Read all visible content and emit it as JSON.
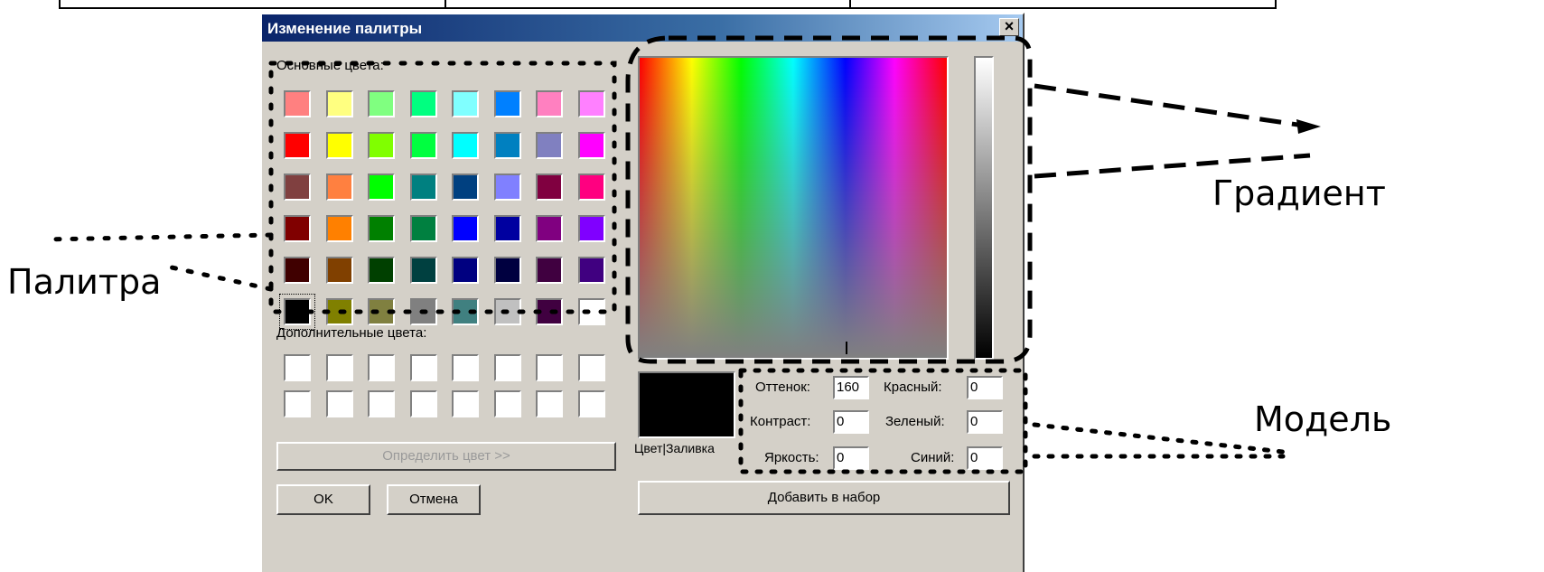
{
  "dialog": {
    "title": "Изменение палитры",
    "close_label": "×",
    "basic_colors_label": "Основные цвета:",
    "custom_colors_label": "Дополнительные цвета:",
    "define_button": "Определить цвет >>",
    "ok_button": "OK",
    "cancel_button": "Отмена",
    "add_button": "Добавить в набор",
    "color_fill_label": "Цвет|Заливка",
    "hue_label": "Оттенок:",
    "hue_value": "160",
    "sat_label": "Контраст:",
    "sat_value": "0",
    "lum_label": "Яркость:",
    "lum_value": "0",
    "red_label": "Красный:",
    "red_value": "0",
    "green_label": "Зеленый:",
    "green_value": "0",
    "blue_label": "Синий:",
    "blue_value": "0",
    "basic_colors": [
      [
        "#ff8080",
        "#ffff80",
        "#80ff80",
        "#00ff80",
        "#80ffff",
        "#0080ff",
        "#ff80c0",
        "#ff80ff"
      ],
      [
        "#ff0000",
        "#ffff00",
        "#80ff00",
        "#00ff40",
        "#00ffff",
        "#0080c0",
        "#8080c0",
        "#ff00ff"
      ],
      [
        "#804040",
        "#ff8040",
        "#00ff00",
        "#008080",
        "#004080",
        "#8080ff",
        "#800040",
        "#ff0080"
      ],
      [
        "#800000",
        "#ff8000",
        "#008000",
        "#008040",
        "#0000ff",
        "#0000a0",
        "#800080",
        "#8000ff"
      ],
      [
        "#400000",
        "#804000",
        "#004000",
        "#004040",
        "#000080",
        "#000040",
        "#400040",
        "#400080"
      ],
      [
        "#000000",
        "#808000",
        "#808040",
        "#808080",
        "#408080",
        "#c0c0c0",
        "#400040",
        "#ffffff"
      ]
    ]
  },
  "callouts": {
    "palette": "Палитра",
    "gradient": "Градиент",
    "model": "Модель"
  }
}
